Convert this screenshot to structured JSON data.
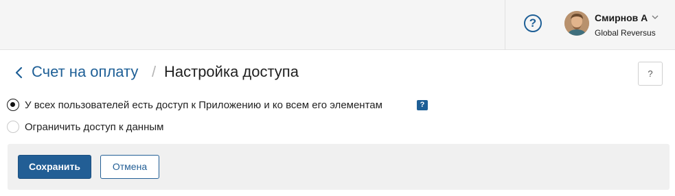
{
  "header": {
    "help_icon_glyph": "?",
    "user": {
      "name": "Смирнов А",
      "organization": "Global Reversus"
    }
  },
  "breadcrumb": {
    "parent": "Счет на оплату",
    "separator": "/",
    "current": "Настройка доступа"
  },
  "hint_button_glyph": "?",
  "access_options": [
    {
      "label": "У всех пользователей есть доступ к Приложению и ко всем его элементам",
      "checked": true
    },
    {
      "label": "Ограничить доступ к данным",
      "checked": false
    }
  ],
  "info_badge_glyph": "?",
  "actions": {
    "save_label": "Сохранить",
    "cancel_label": "Отмена"
  },
  "colors": {
    "accent": "#1e5f96",
    "primary_button": "#225e95",
    "topbar_bg": "#f5f5f5",
    "footer_bg": "#f0f0f0"
  },
  "icons": [
    "help-circle-icon",
    "avatar",
    "chevron-down-icon",
    "back-arrow-icon",
    "hint-icon",
    "info-icon"
  ]
}
